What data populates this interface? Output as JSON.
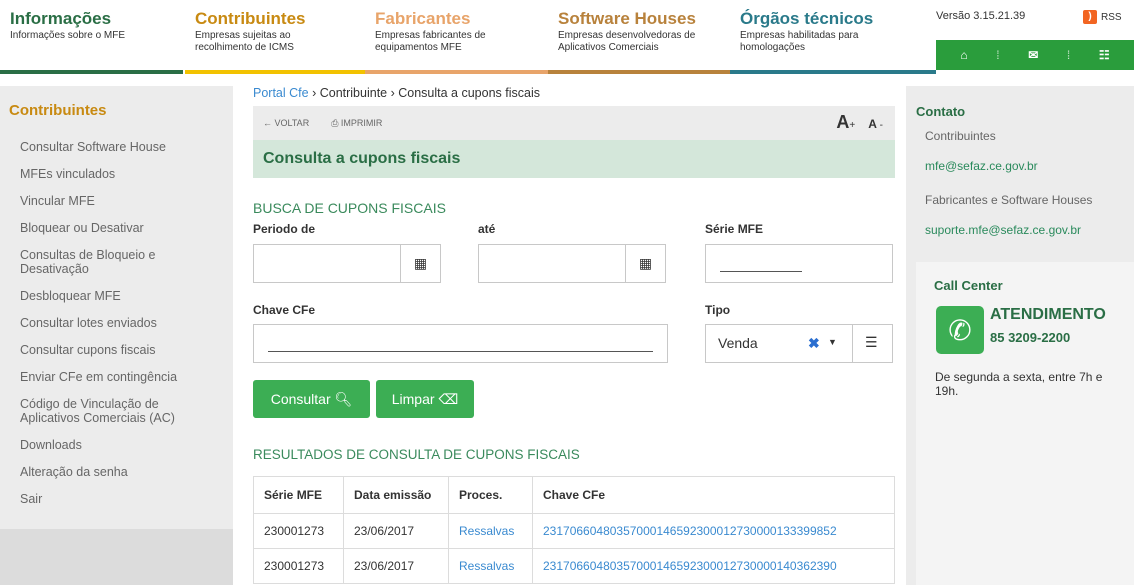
{
  "nav": {
    "items": [
      {
        "title": "Informações",
        "subtitle": "Informações sobre o MFE",
        "color": "#2a6e45"
      },
      {
        "title": "Contribuintes",
        "subtitle": "Empresas sujeitas ao recolhimento de ICMS",
        "color": "#c88a12"
      },
      {
        "title": "Fabricantes",
        "subtitle": "Empresas fabricantes de equipamentos MFE",
        "color": "#e8a46a"
      },
      {
        "title": "Software Houses",
        "subtitle": "Empresas desenvolvedoras de Aplicativos Comerciais",
        "color": "#b8823c"
      },
      {
        "title": "Órgãos técnicos",
        "subtitle": "Empresas habilitadas para homologações",
        "color": "#2a7a8a"
      }
    ],
    "version": "Versão 3.15.21.39",
    "rss": "RSS",
    "icons": [
      "home-icon",
      "mail-icon",
      "sitemap-icon"
    ]
  },
  "sidebar": {
    "title": "Contribuintes",
    "items": [
      "Consultar Software House",
      "MFEs vinculados",
      "Vincular MFE",
      "Bloquear ou Desativar",
      "Consultas de Bloqueio e Desativação",
      "Desbloquear MFE",
      "Consultar lotes enviados",
      "Consultar cupons fiscais",
      "Enviar CFe em contingência",
      "Código de Vinculação de Aplicativos Comerciais (AC)",
      "Downloads",
      "Alteração da senha",
      "Sair"
    ]
  },
  "breadcrumb": {
    "portal": "Portal Cfe",
    "contribuinte": "Contribuinte",
    "current": "Consulta a cupons fiscais"
  },
  "toolbar": {
    "back": "VOLTAR",
    "print": "IMPRIMIR",
    "font_up": "A",
    "font_down": "A"
  },
  "page_title": "Consulta a cupons fiscais",
  "search": {
    "title": "BUSCA DE CUPONS FISCAIS",
    "periodo_label": "Periodo de",
    "ate_label": "até",
    "serie_label": "Série MFE",
    "chave_label": "Chave CFe",
    "tipo_label": "Tipo",
    "tipo_value": "Venda",
    "consultar": "Consultar",
    "limpar": "Limpar"
  },
  "results": {
    "title": "RESULTADOS DE CONSULTA DE CUPONS FISCAIS",
    "columns": [
      "Série MFE",
      "Data emissão",
      "Proces.",
      "Chave CFe"
    ],
    "rows": [
      [
        "230001273",
        "23/06/2017",
        "Ressalvas",
        "23170660480357000146592300012730000133399852"
      ],
      [
        "230001273",
        "23/06/2017",
        "Ressalvas",
        "23170660480357000146592300012730000140362390"
      ]
    ]
  },
  "contact": {
    "title": "Contato",
    "contrib_label": "Contribuintes",
    "contrib_email": "mfe@sefaz.ce.gov.br",
    "fab_label": "Fabricantes e Software Houses",
    "fab_email": "suporte.mfe@sefaz.ce.gov.br",
    "call_title": "Call Center",
    "atendimento": "ATENDIMENTO",
    "phone": "85 3209-2200",
    "hours": "De segunda a sexta, entre 7h e 19h."
  }
}
